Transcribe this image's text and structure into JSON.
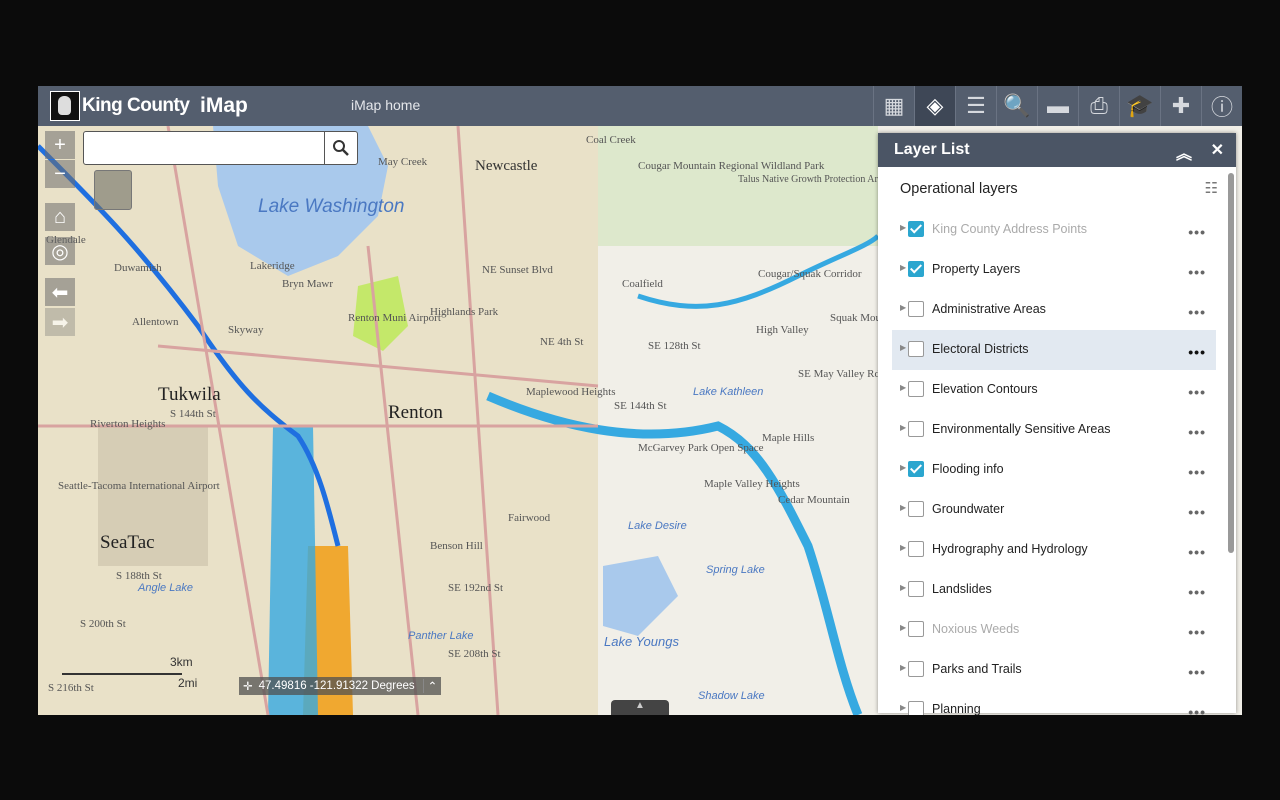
{
  "header": {
    "brand": "King County",
    "app": "iMap",
    "home_link": "iMap home"
  },
  "toolbar": [
    {
      "icon": "grid-icon",
      "glyph": "▦"
    },
    {
      "icon": "layers-icon",
      "glyph": "◈",
      "active": true
    },
    {
      "icon": "legend-icon",
      "glyph": "☰"
    },
    {
      "icon": "search-tool-icon",
      "glyph": "🔍"
    },
    {
      "icon": "folder-more-icon",
      "glyph": "▬"
    },
    {
      "icon": "print-icon",
      "glyph": "⎙"
    },
    {
      "icon": "education-icon",
      "glyph": "🎓"
    },
    {
      "icon": "add-data-icon",
      "glyph": "✚"
    },
    {
      "icon": "info-icon",
      "glyph": "ⓘ"
    }
  ],
  "search": {
    "placeholder": "",
    "value": ""
  },
  "panel": {
    "title": "Layer List",
    "section": "Operational layers",
    "layers": [
      {
        "label": "King County Address Points",
        "checked": true,
        "dim": true
      },
      {
        "label": "Property Layers",
        "checked": true
      },
      {
        "label": "Administrative Areas",
        "checked": false
      },
      {
        "label": "Electoral Districts",
        "checked": false,
        "selected": true
      },
      {
        "label": "Elevation Contours",
        "checked": false
      },
      {
        "label": "Environmentally Sensitive Areas",
        "checked": false
      },
      {
        "label": "Flooding info",
        "checked": true
      },
      {
        "label": "Groundwater",
        "checked": false
      },
      {
        "label": "Hydrography and Hydrology",
        "checked": false
      },
      {
        "label": "Landslides",
        "checked": false
      },
      {
        "label": "Noxious Weeds",
        "checked": false,
        "dim": true
      },
      {
        "label": "Parks and Trails",
        "checked": false
      },
      {
        "label": "Planning",
        "checked": false
      }
    ]
  },
  "map": {
    "coordinates": "47.49816 -121.91322 Degrees",
    "scale_km": "3km",
    "scale_mi": "2mi",
    "labels": {
      "newcastle": "Newcastle",
      "lake_washington": "Lake Washington",
      "renton": "Renton",
      "tukwila": "Tukwila",
      "seatac": "SeaTac",
      "cougar": "Cougar Mountain Regional Wildland Park",
      "coal_creek": "Coal Creek",
      "may_creek": "May Creek",
      "lakeridge": "Lakeridge",
      "bryn_mawr": "Bryn Mawr",
      "skyway": "Skyway",
      "highlands": "Highlands Park",
      "renton_airport": "Renton Muni Airport",
      "maplewood": "Maplewood Heights",
      "lake_kathleen": "Lake Kathleen",
      "maple_hills": "Maple Hills",
      "maple_valley_heights": "Maple Valley Heights",
      "lake_desire": "Lake Desire",
      "spring_lake": "Spring Lake",
      "lake_youngs": "Lake Youngs",
      "fairwood": "Fairwood",
      "benson_hill": "Benson Hill",
      "angle_lake": "Angle Lake",
      "seatac_airport": "Seattle-Tacoma International Airport",
      "riverton": "Riverton Heights",
      "cedar_mountain": "Cedar Mountain",
      "high_valley": "High Valley",
      "cougar_squak": "Cougar/Squak Corridor",
      "squak": "Squak Mountain State Park",
      "shadow_lake": "Shadow Lake",
      "panther_lake": "Panther Lake",
      "duwamish": "Duwamish",
      "glendale": "Glendale",
      "allentown": "Allentown",
      "coalfield": "Coalfield",
      "se_128": "SE 128th St",
      "se_144": "SE 144th St",
      "se_192": "SE 192nd St",
      "se_208": "SE 208th St",
      "s_144": "S 144th St",
      "s_188": "S 188th St",
      "s_200": "S 200th St",
      "s_216": "S 216th St",
      "ne_4": "NE 4th St",
      "sunset": "NE Sunset Blvd",
      "may_valley": "SE May Valley Rd",
      "mcgarvey": "McGarvey Park Open Space",
      "talus": "Talus Native Growth Protection Area"
    },
    "colors": {
      "water": "#a9c9ec",
      "flood": "#36a9e1",
      "river": "#1f6fe0",
      "park": "#cfe3b5",
      "urban": "#e6dcc0",
      "orange": "#f0a830",
      "green": "#c4e86a"
    }
  }
}
